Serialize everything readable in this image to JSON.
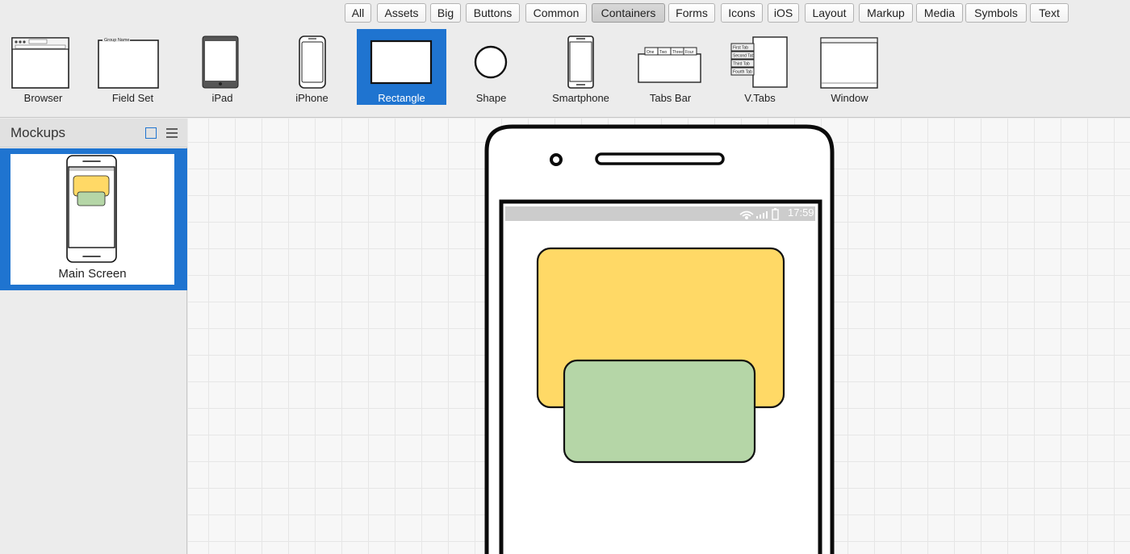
{
  "categories": [
    {
      "label": "All",
      "selected": false
    },
    {
      "label": "Assets",
      "selected": false
    },
    {
      "label": "Big",
      "selected": false
    },
    {
      "label": "Buttons",
      "selected": false
    },
    {
      "label": "Common",
      "selected": false
    },
    {
      "label": "Containers",
      "selected": true
    },
    {
      "label": "Forms",
      "selected": false
    },
    {
      "label": "Icons",
      "selected": false
    },
    {
      "label": "iOS",
      "selected": false
    },
    {
      "label": "Layout",
      "selected": false
    },
    {
      "label": "Markup",
      "selected": false
    },
    {
      "label": "Media",
      "selected": false
    },
    {
      "label": "Symbols",
      "selected": false
    },
    {
      "label": "Text",
      "selected": false
    }
  ],
  "library": [
    {
      "label": "Browser",
      "icon": "browser-icon",
      "selected": false
    },
    {
      "label": "Field Set",
      "icon": "field-set-icon",
      "selected": false,
      "caption": "Group Name"
    },
    {
      "label": "iPad",
      "icon": "ipad-icon",
      "selected": false
    },
    {
      "label": "iPhone",
      "icon": "iphone-icon",
      "selected": false
    },
    {
      "label": "Rectangle",
      "icon": "rectangle-icon",
      "selected": true
    },
    {
      "label": "Shape",
      "icon": "circle-shape-icon",
      "selected": false
    },
    {
      "label": "Smartphone",
      "icon": "smartphone-icon",
      "selected": false
    },
    {
      "label": "Tabs Bar",
      "icon": "tabs-bar-icon",
      "selected": false,
      "tabs": [
        "One",
        "Two",
        "Three",
        "Four"
      ]
    },
    {
      "label": "V.Tabs",
      "icon": "vertical-tabs-icon",
      "selected": false,
      "tabs": [
        "First Tab",
        "Second Tab",
        "Third Tab",
        "Fourth Tab"
      ]
    },
    {
      "label": "Window",
      "icon": "window-icon",
      "selected": false
    }
  ],
  "sidebar": {
    "title": "Mockups",
    "mockups": [
      {
        "label": "Main Screen",
        "selected": true
      }
    ]
  },
  "canvas": {
    "status_time": "17:59"
  },
  "colors": {
    "accent": "#1f74d0",
    "yellow_rect": "#ffd966",
    "green_rect": "#b5d6a7",
    "status_bar": "#cccccc"
  }
}
